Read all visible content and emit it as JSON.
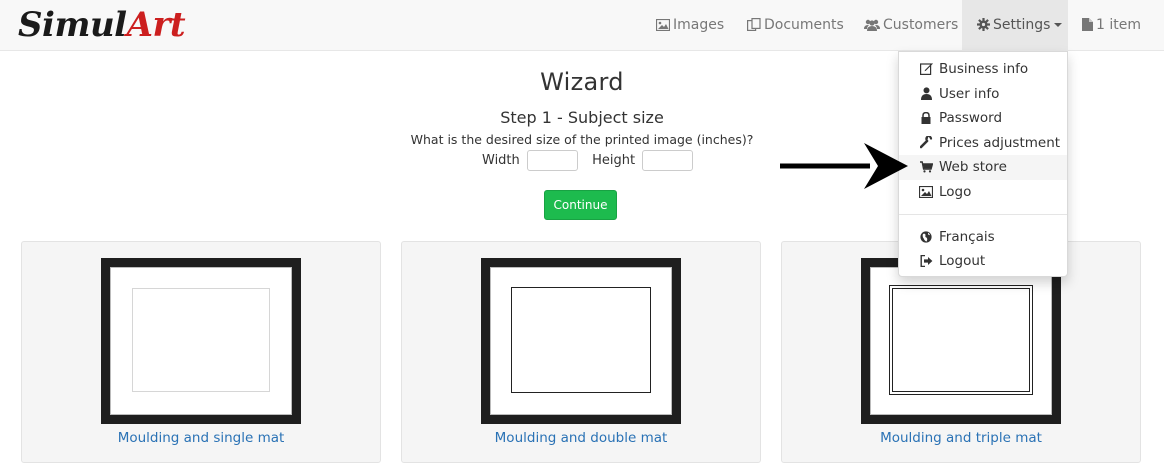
{
  "brand": {
    "part1": "Simul",
    "part2": "Art"
  },
  "nav": {
    "images": "Images",
    "documents": "Documents",
    "customers": "Customers",
    "settings": "Settings",
    "cart": "1 item"
  },
  "settings_menu": {
    "items": [
      {
        "label": "Business info",
        "icon": "edit-icon"
      },
      {
        "label": "User info",
        "icon": "user-icon"
      },
      {
        "label": "Password",
        "icon": "lock-icon"
      },
      {
        "label": "Prices adjustment",
        "icon": "wrench-icon"
      },
      {
        "label": "Web store",
        "icon": "cart-icon"
      },
      {
        "label": "Logo",
        "icon": "picture-icon"
      }
    ],
    "lang": {
      "label": "Français",
      "icon": "globe-icon"
    },
    "logout": {
      "label": "Logout",
      "icon": "logout-icon"
    }
  },
  "wizard": {
    "title": "Wizard",
    "step": "Step 1 - Subject size",
    "question": "What is the desired size of the printed image (inches)?",
    "width_label": "Width",
    "height_label": "Height",
    "width_value": "",
    "height_value": "",
    "continue": "Continue"
  },
  "options": [
    {
      "label": "Moulding and single mat"
    },
    {
      "label": "Moulding and double mat"
    },
    {
      "label": "Moulding and triple mat"
    }
  ],
  "colors": {
    "brand_red": "#cc1f1f",
    "continue_green": "#1dbb4e",
    "link_blue": "#2a72b5"
  }
}
